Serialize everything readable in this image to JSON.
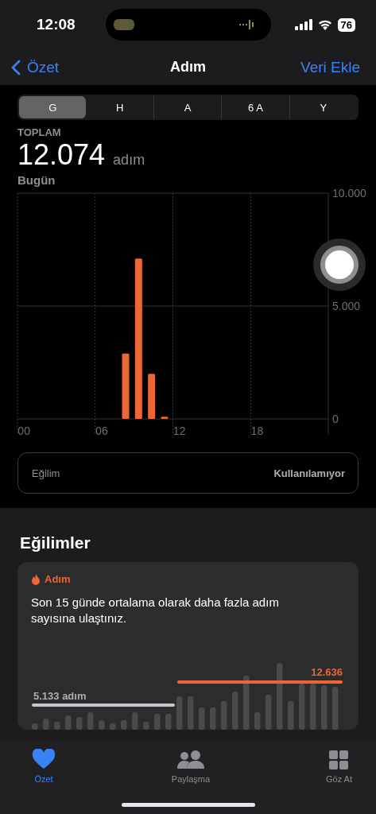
{
  "status_bar": {
    "time": "12:08",
    "battery": "76"
  },
  "nav": {
    "back": "Özet",
    "title": "Adım",
    "action": "Veri Ekle"
  },
  "segments": [
    {
      "label": "G",
      "selected": true
    },
    {
      "label": "H",
      "selected": false
    },
    {
      "label": "A",
      "selected": false
    },
    {
      "label": "6 A",
      "selected": false
    },
    {
      "label": "Y",
      "selected": false
    }
  ],
  "summary": {
    "label": "TOPLAM",
    "value": "12.074",
    "unit": "adım",
    "period": "Bugün"
  },
  "chart": {
    "chart_data": {
      "type": "bar",
      "x": [
        8,
        9,
        10,
        11
      ],
      "xlim": [
        -0.5,
        23.5
      ],
      "series": [
        {
          "color": "#ec6735",
          "values": [
            2900,
            7100,
            2000,
            100
          ]
        }
      ],
      "ylim": [
        0,
        10000
      ],
      "yticks": [
        {
          "value": 0,
          "label": "0"
        },
        {
          "value": 5000,
          "label": "5.000"
        },
        {
          "value": 10000,
          "label": "10.000"
        }
      ],
      "xticks": [
        {
          "value": 0,
          "label": "00"
        },
        {
          "value": 6,
          "label": "06"
        },
        {
          "value": 12,
          "label": "12"
        },
        {
          "value": 18,
          "label": "18"
        }
      ]
    }
  },
  "trend_row": {
    "label": "Eğilim",
    "value": "Kullanılamıyor"
  },
  "trends": {
    "title": "Eğilimler",
    "card": {
      "category": "Adım",
      "message": "Son 15 günde ortalama olarak daha fazla adım sayısına ulaştınız.",
      "old_average": "5.133 adım",
      "new_average": "12.636"
    }
  },
  "tab_bar": [
    {
      "label": "Özet",
      "selected": true,
      "kind": "heart"
    },
    {
      "label": "Paylaşma",
      "selected": false,
      "kind": "people"
    },
    {
      "label": "Göz At",
      "selected": false,
      "kind": "grid"
    }
  ]
}
